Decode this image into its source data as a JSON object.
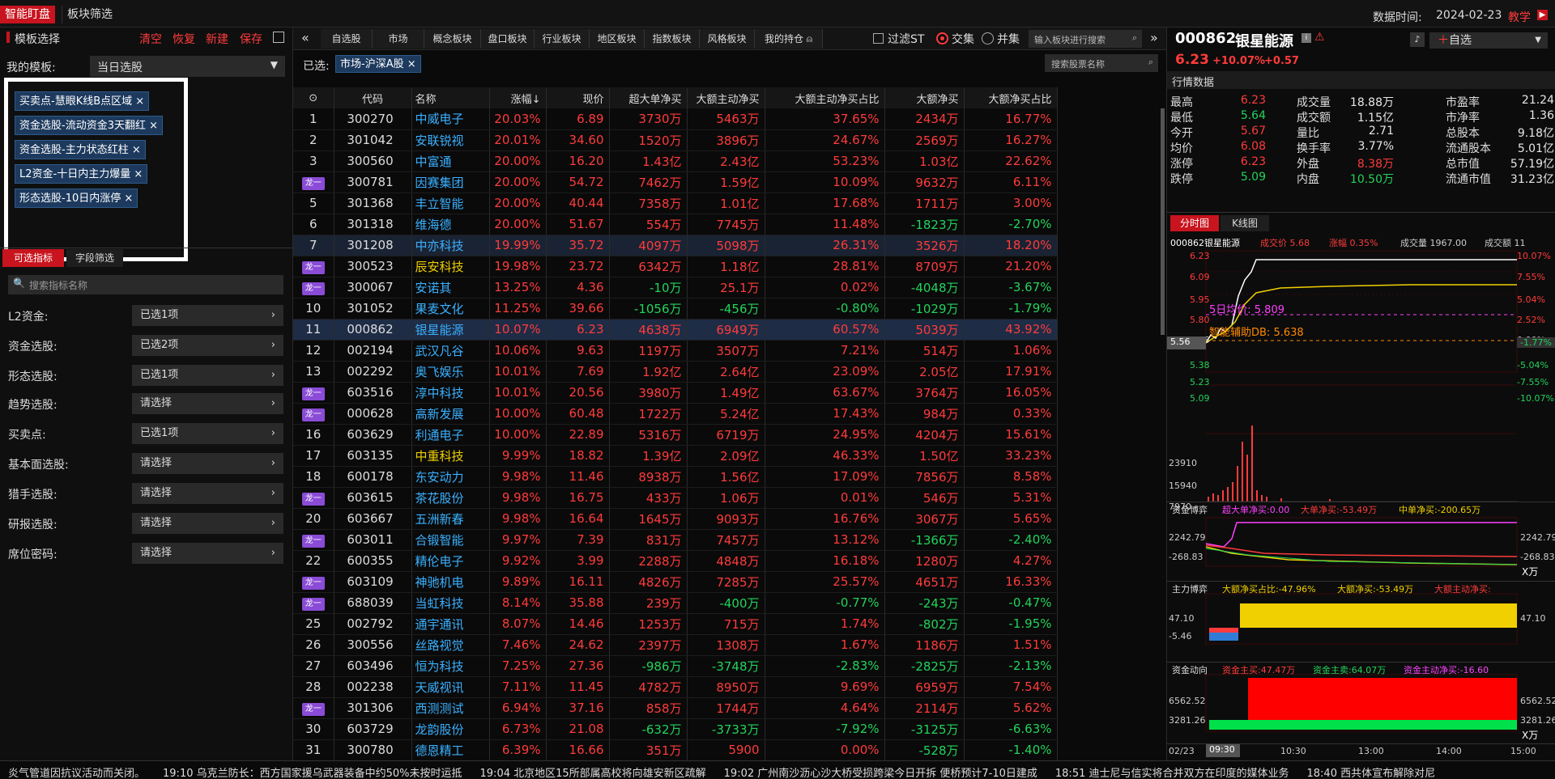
{
  "topbar": {
    "tab_active": "智能盯盘",
    "tab2": "板块筛选",
    "date_label": "数据时间:",
    "date": "2024-02-23",
    "teach": "教学"
  },
  "left": {
    "title": "模板选择",
    "actions": [
      "清空",
      "恢复",
      "新建",
      "保存"
    ],
    "my_template_label": "我的模板:",
    "my_template_value": "当日选股",
    "chips": [
      "买卖点-慧眼K线B点区域",
      "资金选股-流动资金3天翻红",
      "资金选股-主力状态红柱",
      "L2资金-十日内主力爆量",
      "形态选股-10日内涨停"
    ],
    "tabs": [
      "可选指标",
      "字段筛选"
    ],
    "search_placeholder": "搜索指标名称",
    "filters": [
      {
        "label": "L2资金:",
        "value": "已选1项"
      },
      {
        "label": "资金选股:",
        "value": "已选2项"
      },
      {
        "label": "形态选股:",
        "value": "已选1项"
      },
      {
        "label": "趋势选股:",
        "value": "请选择"
      },
      {
        "label": "买卖点:",
        "value": "已选1项"
      },
      {
        "label": "基本面选股:",
        "value": "请选择"
      },
      {
        "label": "猎手选股:",
        "value": "请选择"
      },
      {
        "label": "研报选股:",
        "value": "请选择"
      },
      {
        "label": "席位密码:",
        "value": "请选择"
      }
    ]
  },
  "mid": {
    "nav": [
      "自选股",
      "市场",
      "概念板块",
      "盘口板块",
      "行业板块",
      "地区板块",
      "指数板块",
      "风格板块",
      "我的持仓"
    ],
    "filter_st": "过滤ST",
    "opt_and": "交集",
    "opt_or": "并集",
    "search_sector_placeholder": "输入板块进行搜索",
    "selected_label": "已选:",
    "selected_chip": "市场-沪深A股",
    "search_stock_placeholder": "搜索股票名称",
    "columns": [
      "",
      "代码",
      "名称",
      "涨幅↓",
      "现价",
      "超大单净买",
      "大额主动净买",
      "大额主动净买占比",
      "大额净买",
      "大额净买占比"
    ],
    "dragon": "龙一",
    "rows": [
      {
        "idx": "1",
        "code": "300270",
        "name": "中威电子",
        "chg": "20.03%",
        "price": "6.89",
        "a": "3730万",
        "b": "5463万",
        "c": "37.65%",
        "d": "2434万",
        "e": "16.77%"
      },
      {
        "idx": "2",
        "code": "301042",
        "name": "安联锐视",
        "chg": "20.01%",
        "price": "34.60",
        "a": "1520万",
        "b": "3896万",
        "c": "24.67%",
        "d": "2569万",
        "e": "16.27%"
      },
      {
        "idx": "3",
        "code": "300560",
        "name": "中富通",
        "chg": "20.00%",
        "price": "16.20",
        "a": "1.43亿",
        "b": "2.43亿",
        "c": "53.23%",
        "d": "1.03亿",
        "e": "22.62%"
      },
      {
        "idx": "D",
        "code": "300781",
        "name": "因赛集团",
        "chg": "20.00%",
        "price": "54.72",
        "a": "7462万",
        "b": "1.59亿",
        "c": "10.09%",
        "d": "9632万",
        "e": "6.11%"
      },
      {
        "idx": "5",
        "code": "301368",
        "name": "丰立智能",
        "chg": "20.00%",
        "price": "40.44",
        "a": "7358万",
        "b": "1.01亿",
        "c": "17.68%",
        "d": "1711万",
        "e": "3.00%"
      },
      {
        "idx": "6",
        "code": "301318",
        "name": "维海德",
        "chg": "20.00%",
        "price": "51.67",
        "a": "554万",
        "b": "7745万",
        "c": "11.48%",
        "d": "-1823万",
        "e": "-2.70%"
      },
      {
        "idx": "7",
        "code": "301208",
        "name": "中亦科技",
        "chg": "19.99%",
        "price": "35.72",
        "a": "4097万",
        "b": "5098万",
        "c": "26.31%",
        "d": "3526万",
        "e": "18.20%"
      },
      {
        "idx": "D",
        "code": "300523",
        "name": "辰安科技",
        "chg": "19.98%",
        "price": "23.72",
        "a": "6342万",
        "b": "1.18亿",
        "c": "28.81%",
        "d": "8709万",
        "e": "21.20%"
      },
      {
        "idx": "D",
        "code": "300067",
        "name": "安诺其",
        "chg": "13.25%",
        "price": "4.36",
        "a": "-10万",
        "b": "25.1万",
        "c": "0.02%",
        "d": "-4048万",
        "e": "-3.67%"
      },
      {
        "idx": "10",
        "code": "301052",
        "name": "果麦文化",
        "chg": "11.25%",
        "price": "39.66",
        "a": "-1056万",
        "b": "-456万",
        "c": "-0.80%",
        "d": "-1029万",
        "e": "-1.79%"
      },
      {
        "idx": "11",
        "code": "000862",
        "name": "银星能源",
        "chg": "10.07%",
        "price": "6.23",
        "a": "4638万",
        "b": "6949万",
        "c": "60.57%",
        "d": "5039万",
        "e": "43.92%"
      },
      {
        "idx": "12",
        "code": "002194",
        "name": "武汉凡谷",
        "chg": "10.06%",
        "price": "9.63",
        "a": "1197万",
        "b": "3507万",
        "c": "7.21%",
        "d": "514万",
        "e": "1.06%"
      },
      {
        "idx": "13",
        "code": "002292",
        "name": "奥飞娱乐",
        "chg": "10.01%",
        "price": "7.69",
        "a": "1.92亿",
        "b": "2.64亿",
        "c": "23.09%",
        "d": "2.05亿",
        "e": "17.91%"
      },
      {
        "idx": "D",
        "code": "603516",
        "name": "淳中科技",
        "chg": "10.01%",
        "price": "20.56",
        "a": "3980万",
        "b": "1.49亿",
        "c": "63.67%",
        "d": "3764万",
        "e": "16.05%"
      },
      {
        "idx": "D",
        "code": "000628",
        "name": "高新发展",
        "chg": "10.00%",
        "price": "60.48",
        "a": "1722万",
        "b": "5.24亿",
        "c": "17.43%",
        "d": "984万",
        "e": "0.33%"
      },
      {
        "idx": "16",
        "code": "603629",
        "name": "利通电子",
        "chg": "10.00%",
        "price": "22.89",
        "a": "5316万",
        "b": "6719万",
        "c": "24.95%",
        "d": "4204万",
        "e": "15.61%"
      },
      {
        "idx": "17",
        "code": "603135",
        "name": "中重科技",
        "chg": "9.99%",
        "price": "18.82",
        "a": "1.39亿",
        "b": "2.09亿",
        "c": "46.33%",
        "d": "1.50亿",
        "e": "33.23%"
      },
      {
        "idx": "18",
        "code": "600178",
        "name": "东安动力",
        "chg": "9.98%",
        "price": "11.46",
        "a": "8938万",
        "b": "1.56亿",
        "c": "17.09%",
        "d": "7856万",
        "e": "8.58%"
      },
      {
        "idx": "D",
        "code": "603615",
        "name": "茶花股份",
        "chg": "9.98%",
        "price": "16.75",
        "a": "433万",
        "b": "1.06万",
        "c": "0.01%",
        "d": "546万",
        "e": "5.31%"
      },
      {
        "idx": "20",
        "code": "603667",
        "name": "五洲新春",
        "chg": "9.98%",
        "price": "16.64",
        "a": "1645万",
        "b": "9093万",
        "c": "16.76%",
        "d": "3067万",
        "e": "5.65%"
      },
      {
        "idx": "D",
        "code": "603011",
        "name": "合锻智能",
        "chg": "9.97%",
        "price": "7.39",
        "a": "831万",
        "b": "7457万",
        "c": "13.12%",
        "d": "-1366万",
        "e": "-2.40%"
      },
      {
        "idx": "22",
        "code": "600355",
        "name": "精伦电子",
        "chg": "9.92%",
        "price": "3.99",
        "a": "2288万",
        "b": "4848万",
        "c": "16.18%",
        "d": "1280万",
        "e": "4.27%"
      },
      {
        "idx": "D",
        "code": "603109",
        "name": "神驰机电",
        "chg": "9.89%",
        "price": "16.11",
        "a": "4826万",
        "b": "7285万",
        "c": "25.57%",
        "d": "4651万",
        "e": "16.33%"
      },
      {
        "idx": "D",
        "code": "688039",
        "name": "当虹科技",
        "chg": "8.14%",
        "price": "35.88",
        "a": "239万",
        "b": "-400万",
        "c": "-0.77%",
        "d": "-243万",
        "e": "-0.47%"
      },
      {
        "idx": "25",
        "code": "002792",
        "name": "通宇通讯",
        "chg": "8.07%",
        "price": "14.46",
        "a": "1253万",
        "b": "715万",
        "c": "1.74%",
        "d": "-802万",
        "e": "-1.95%"
      },
      {
        "idx": "26",
        "code": "300556",
        "name": "丝路视觉",
        "chg": "7.46%",
        "price": "24.62",
        "a": "2397万",
        "b": "1308万",
        "c": "1.67%",
        "d": "1186万",
        "e": "1.51%"
      },
      {
        "idx": "27",
        "code": "603496",
        "name": "恒为科技",
        "chg": "7.25%",
        "price": "27.36",
        "a": "-986万",
        "b": "-3748万",
        "c": "-2.83%",
        "d": "-2825万",
        "e": "-2.13%"
      },
      {
        "idx": "28",
        "code": "002238",
        "name": "天威视讯",
        "chg": "7.11%",
        "price": "11.45",
        "a": "4782万",
        "b": "8950万",
        "c": "9.69%",
        "d": "6959万",
        "e": "7.54%"
      },
      {
        "idx": "D",
        "code": "301306",
        "name": "西测测试",
        "chg": "6.94%",
        "price": "37.16",
        "a": "858万",
        "b": "1744万",
        "c": "4.64%",
        "d": "2114万",
        "e": "5.62%"
      },
      {
        "idx": "30",
        "code": "603729",
        "name": "龙韵股份",
        "chg": "6.73%",
        "price": "21.08",
        "a": "-632万",
        "b": "-3733万",
        "c": "-7.92%",
        "d": "-3125万",
        "e": "-6.63%"
      },
      {
        "idx": "31",
        "code": "300780",
        "name": "德恩精工",
        "chg": "6.39%",
        "price": "16.66",
        "a": "351万",
        "b": "5900",
        "c": "0.00%",
        "d": "-528万",
        "e": "-1.40%"
      }
    ]
  },
  "right": {
    "code": "000862",
    "name": "银星能源",
    "add_watch": "自选",
    "price": "6.23",
    "chg_pct": "+10.07%",
    "chg": "+0.57",
    "section": "行情数据",
    "quote": [
      [
        "最高",
        "6.23",
        "成交量",
        "18.88万",
        "市盈率",
        "21.24"
      ],
      [
        "最低",
        "5.64",
        "成交额",
        "1.15亿",
        "市净率",
        "1.36"
      ],
      [
        "今开",
        "5.67",
        "量比",
        "2.71",
        "总股本",
        "9.18亿"
      ],
      [
        "均价",
        "6.08",
        "换手率",
        "3.77%",
        "流通股本",
        "5.01亿"
      ],
      [
        "涨停",
        "6.23",
        "外盘",
        "8.38万",
        "总市值",
        "57.19亿"
      ],
      [
        "跌停",
        "5.09",
        "内盘",
        "10.50万",
        "流通市值",
        "31.23亿"
      ]
    ],
    "chart_tabs": [
      "分时图",
      "K线图"
    ],
    "info": {
      "code_name": "000862银星能源",
      "price_lbl": "成交价 5.68",
      "chg_lbl": "涨幅 0.35%",
      "vol_lbl": "成交量 1967.00",
      "amt_lbl": "成交额 11"
    },
    "y_left": [
      "6.23",
      "6.09",
      "5.95",
      "5.80",
      "5.66",
      "5.56",
      "5.38",
      "5.23",
      "5.09"
    ],
    "y_right": [
      "10.07%",
      "7.55%",
      "5.04%",
      "2.52%",
      "0.00%",
      "-1.77%",
      "-5.04%",
      "-7.55%",
      "-10.07%"
    ],
    "ma_label": "5日均价: 5.809",
    "db_label": "智能辅助DB: 5.638",
    "vol_axis": [
      "23910",
      "15940",
      "7970"
    ],
    "panel1": {
      "title": "资金博弈",
      "l1": "超大单净买:0.00",
      "l2": "大单净买:-53.49万",
      "l3": "中单净买:-200.65万",
      "y": [
        "2242.79",
        "-268.83"
      ],
      "unit": "X万"
    },
    "panel2": {
      "title": "主力博弈",
      "l1": "大额净买占比:-47.96%",
      "l2": "大额净买:-53.49万",
      "l3": "大额主动净买:",
      "y": [
        "47.10",
        "-5.46"
      ]
    },
    "panel3": {
      "title": "资金动向",
      "l1": "资金主买:47.47万",
      "l2": "资金主卖:64.07万",
      "l3": "资金主动净买:-16.60",
      "y": [
        "6562.52",
        "3281.26"
      ],
      "unit": "X万"
    },
    "time_axis": [
      "02/23",
      "09:30",
      "10:30",
      "13:00",
      "14:00",
      "15:00"
    ]
  },
  "ticker": [
    "炎气管道因抗议活动而关闭。",
    "19:10 乌克兰防长：西方国家援乌武器装备中约50%未按时运抵",
    "19:04 北京地区15所部属高校将向雄安新区疏解",
    "19:02 广州南沙沥心沙大桥受损跨梁今日开拆 便桥预计7-10日建成",
    "18:51 迪士尼与信实将合并双方在印度的媒体业务",
    "18:40 西共体宣布解除对尼"
  ]
}
